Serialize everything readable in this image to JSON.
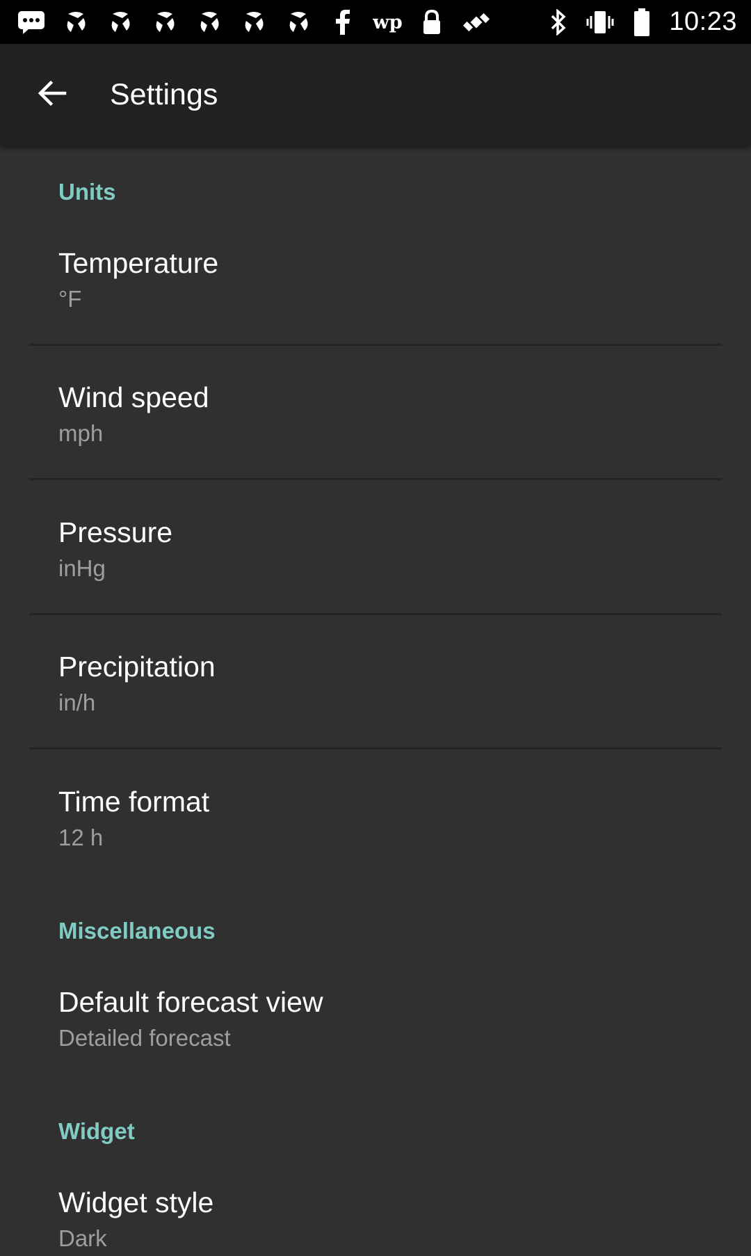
{
  "status_bar": {
    "time": "10:23",
    "left_icons": [
      "message-icon",
      "pinwheel-icon",
      "pinwheel-icon",
      "pinwheel-icon",
      "pinwheel-icon",
      "pinwheel-icon",
      "pinwheel-icon",
      "facebook-icon",
      "washington-post-icon",
      "lock-icon",
      "satellite-icon"
    ],
    "right_icons": [
      "bluetooth-icon",
      "vibrate-icon",
      "battery-icon"
    ]
  },
  "app_bar": {
    "title": "Settings"
  },
  "sections": {
    "units": {
      "header": "Units",
      "temperature": {
        "title": "Temperature",
        "summary": "°F"
      },
      "wind_speed": {
        "title": "Wind speed",
        "summary": "mph"
      },
      "pressure": {
        "title": "Pressure",
        "summary": "inHg"
      },
      "precipitation": {
        "title": "Precipitation",
        "summary": "in/h"
      },
      "time_format": {
        "title": "Time format",
        "summary": "12 h"
      }
    },
    "misc": {
      "header": "Miscellaneous",
      "default_forecast_view": {
        "title": "Default forecast view",
        "summary": "Detailed forecast"
      }
    },
    "widget": {
      "header": "Widget",
      "widget_style": {
        "title": "Widget style",
        "summary": "Dark"
      }
    }
  },
  "colors": {
    "accent": "#80cbc4",
    "background": "#303030",
    "app_bar": "#212121",
    "primary_text": "#ffffff",
    "secondary_text": "#9e9e9e"
  }
}
